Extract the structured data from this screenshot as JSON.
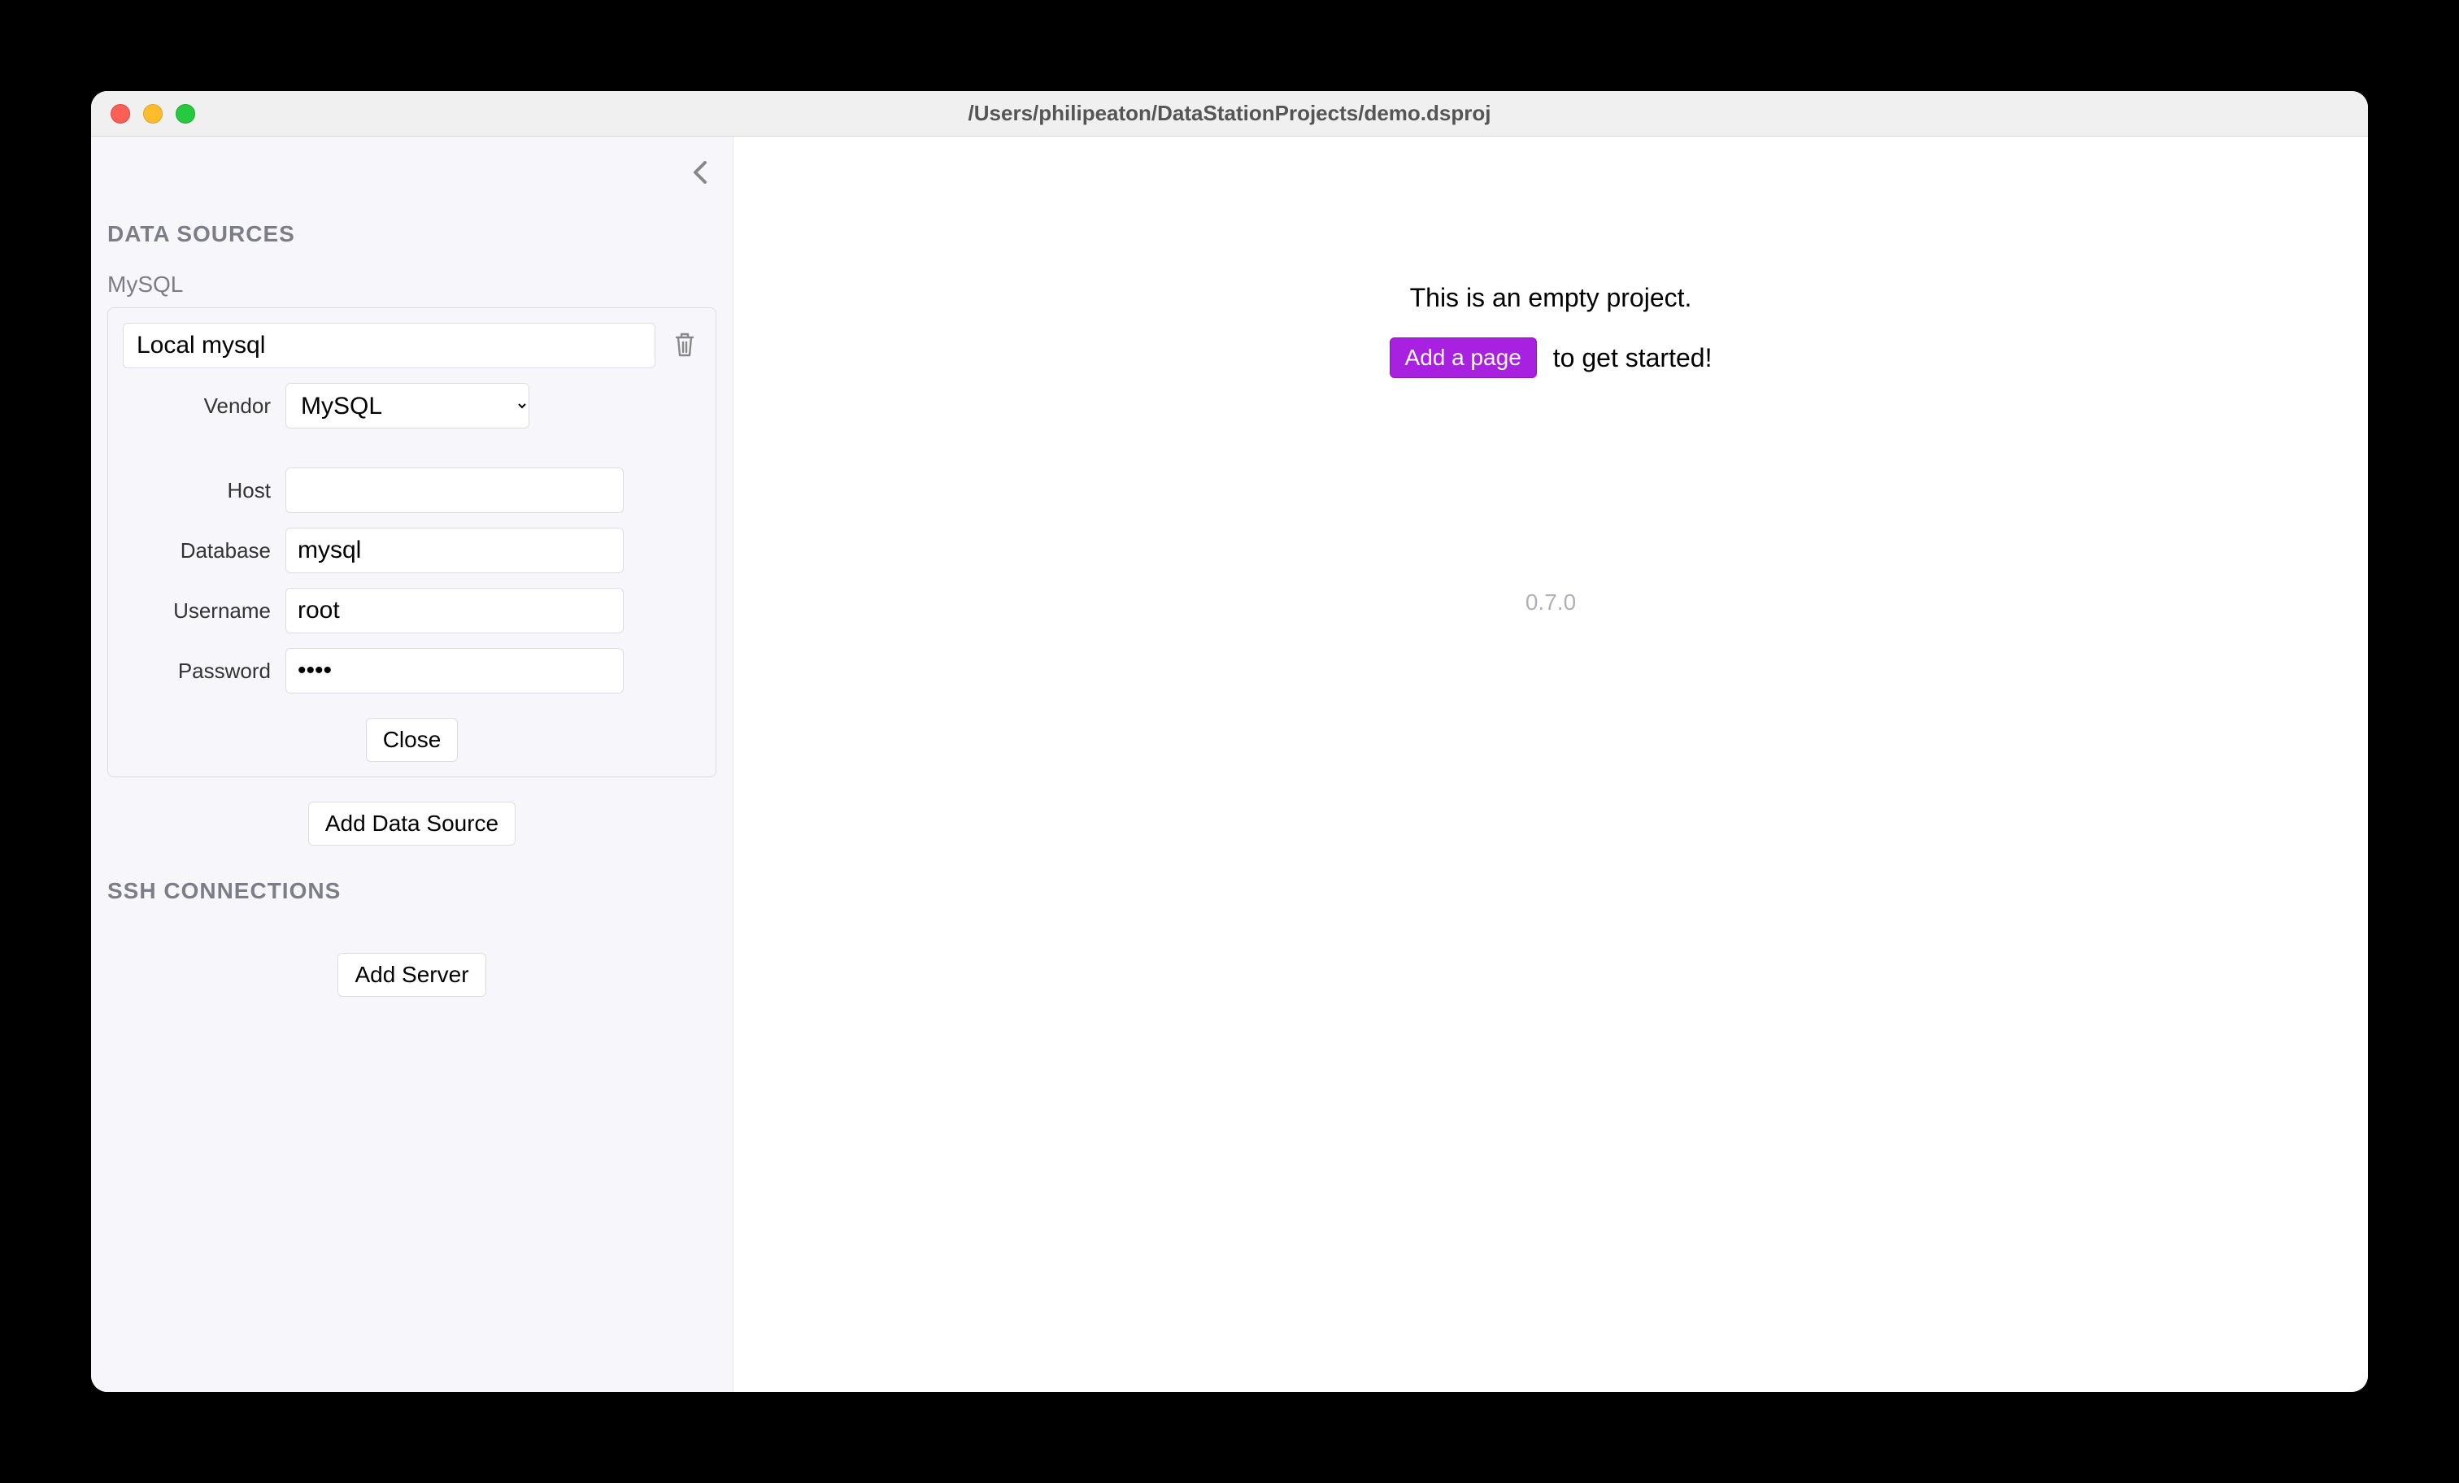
{
  "window": {
    "title": "/Users/philipeaton/DataStationProjects/demo.dsproj"
  },
  "sidebar": {
    "sections": {
      "datasources": {
        "header": "DATA SOURCES",
        "item_label": "MySQL",
        "add_button": "Add Data Source"
      },
      "ssh": {
        "header": "SSH CONNECTIONS",
        "add_button": "Add Server"
      }
    },
    "datasource": {
      "name": "Local mysql",
      "fields": {
        "vendor": {
          "label": "Vendor",
          "value": "MySQL"
        },
        "host": {
          "label": "Host",
          "value": ""
        },
        "database": {
          "label": "Database",
          "value": "mysql"
        },
        "username": {
          "label": "Username",
          "value": "root"
        },
        "password": {
          "label": "Password",
          "value": "••••"
        }
      },
      "close_button": "Close"
    }
  },
  "main": {
    "empty_project_text": "This is an empty project.",
    "add_page_button": "Add a page",
    "get_started_text": "to get started!",
    "version": "0.7.0"
  }
}
